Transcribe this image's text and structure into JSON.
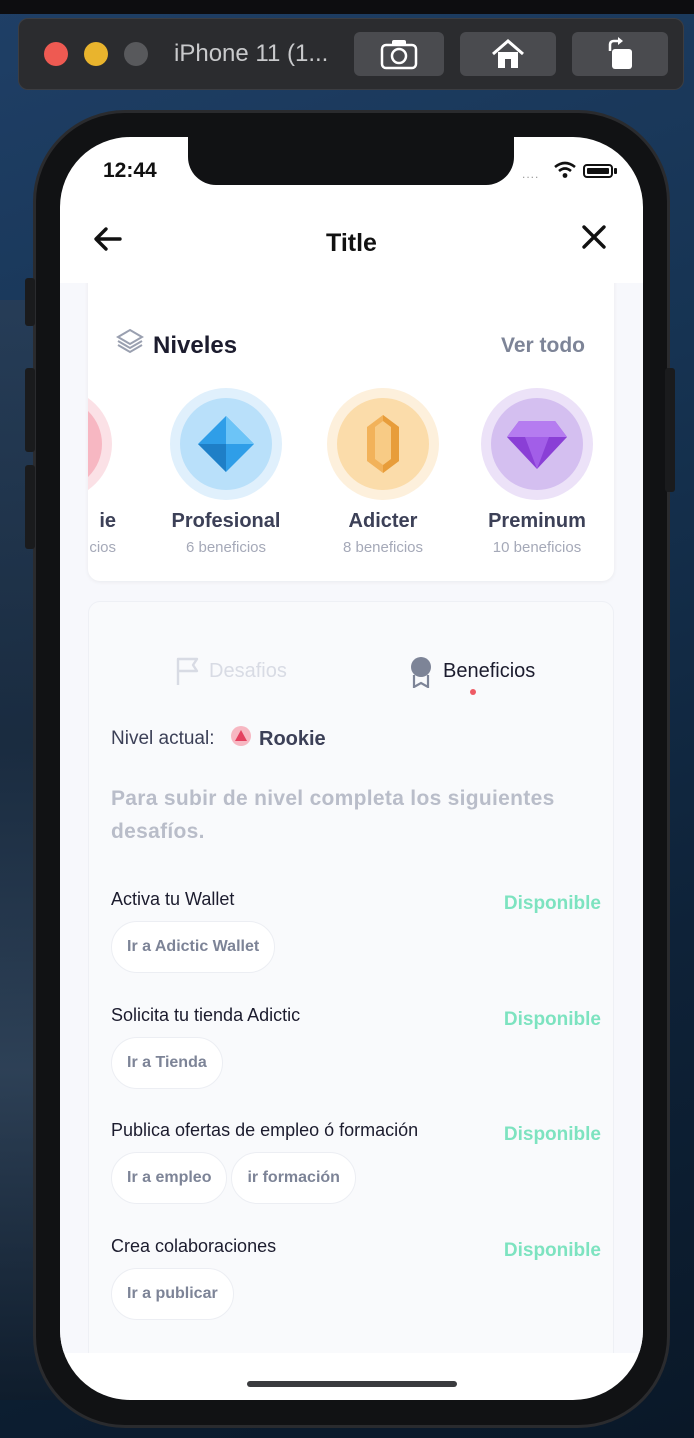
{
  "simulator": {
    "title": "iPhone 11 (1...",
    "toolbar_icons": [
      "camera-icon",
      "home-icon",
      "rotate-icon"
    ]
  },
  "status_bar": {
    "time": "12:44",
    "signal": "....",
    "icons": [
      "wifi-icon",
      "battery-icon"
    ]
  },
  "nav": {
    "title": "Title",
    "back_icon": "back-arrow-icon",
    "close_icon": "close-icon"
  },
  "levels": {
    "title": "Niveles",
    "see_all": "Ver todo",
    "items": [
      {
        "name": "ie",
        "benefits": "cios",
        "color": "#f7b7c2"
      },
      {
        "name": "Profesional",
        "benefits": "6 beneficios",
        "color": "#57b6f4"
      },
      {
        "name": "Adicter",
        "benefits": "8 beneficios",
        "color": "#f5c06b"
      },
      {
        "name": "Preminum",
        "benefits": "10 beneficios",
        "color": "#9b5de5"
      }
    ]
  },
  "tabs": {
    "items": [
      {
        "label": "Desafios",
        "active": false
      },
      {
        "label": "Beneficios",
        "active": true
      }
    ]
  },
  "current_level": {
    "label": "Nivel actual:",
    "value": "Rookie"
  },
  "description": "Para subir de nivel completa los siguientes desafíos.",
  "tasks": [
    {
      "title": "Activa tu Wallet",
      "status": "Disponible",
      "actions": [
        "Ir a Adictic Wallet"
      ]
    },
    {
      "title": "Solicita tu tienda Adictic",
      "status": "Disponible",
      "actions": [
        "Ir a Tienda"
      ]
    },
    {
      "title": "Publica ofertas de empleo ó formación",
      "status": "Disponible",
      "actions": [
        "Ir a empleo",
        "ir formación"
      ]
    },
    {
      "title": "Crea colaboraciones",
      "status": "Disponible",
      "actions": [
        "Ir a publicar"
      ]
    }
  ],
  "colors": {
    "accent_available": "#7de3c0",
    "tab_dot": "#ee5a64",
    "text_dark": "#1c1c2e",
    "text_muted": "#7d8497"
  }
}
